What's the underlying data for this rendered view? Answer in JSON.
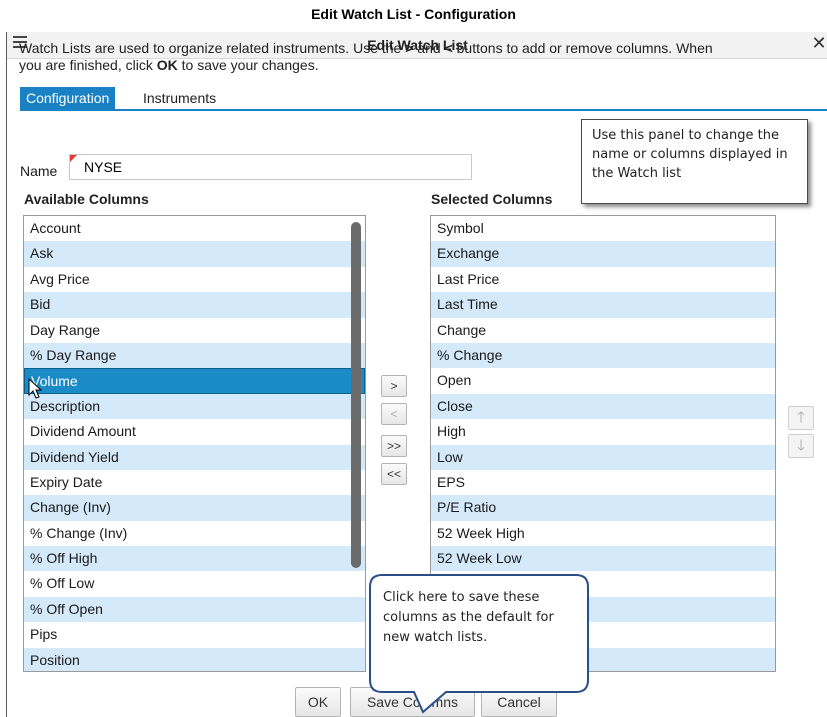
{
  "caption": "Edit Watch List - Configuration",
  "dialog": {
    "title": "Edit Watch List",
    "close_glyph": "✕",
    "intro_line1_a": "Watch Lists are used to organize related instruments.  Use the ",
    "intro_gt": ">",
    "intro_line1_b": " and ",
    "intro_lt": "<",
    "intro_line1_c": " buttons to add or remove columns. When",
    "intro_line2_a": "you are finished, click ",
    "intro_ok": "OK",
    "intro_line2_b": " to save your changes."
  },
  "tabs": [
    {
      "label": "Configuration",
      "active": true
    },
    {
      "label": "Instruments",
      "active": false
    }
  ],
  "name_field": {
    "label": "Name",
    "value": "NYSE"
  },
  "available": {
    "heading": "Available Columns",
    "items": [
      "Account",
      "Ask",
      "Avg Price",
      "Bid",
      "Day Range",
      "% Day Range",
      "Volume",
      "Description",
      "Dividend Amount",
      "Dividend Yield",
      "Expiry Date",
      "Change (Inv)",
      "% Change (Inv)",
      "% Off High",
      "% Off Low",
      "% Off Open",
      "Pips",
      "Position"
    ],
    "selected_index": 6
  },
  "selected": {
    "heading": "Selected Columns",
    "items": [
      "Symbol",
      "Exchange",
      "Last Price",
      "Last Time",
      "Change",
      "% Change",
      "Open",
      "Close",
      "High",
      "Low",
      "EPS",
      "P/E Ratio",
      "52 Week High",
      "52 Week Low",
      "",
      "",
      "",
      ""
    ]
  },
  "transfer_buttons": {
    "add": ">",
    "remove": "<",
    "add_all": ">>",
    "remove_all": "<<"
  },
  "order_buttons": {
    "up": "🡑",
    "down": "🡓"
  },
  "bottom_buttons": {
    "ok": "OK",
    "save_columns": "Save Columns",
    "cancel": "Cancel"
  },
  "callouts": {
    "config_panel": "Use this panel to change the name or columns displayed in the Watch list",
    "save_columns": "Click here to save these columns as the default for new watch lists."
  },
  "colors": {
    "accent": "#1a82c4",
    "row_alt": "#d4e9fa",
    "row_selected": "#1a8bc7"
  }
}
